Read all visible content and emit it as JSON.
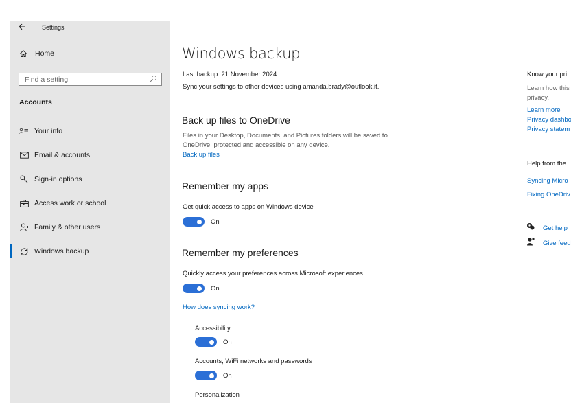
{
  "app": {
    "title": "Settings"
  },
  "sidebar": {
    "home_label": "Home",
    "search_placeholder": "Find a setting",
    "section_title": "Accounts",
    "items": [
      {
        "label": "Your info",
        "icon": "person-list-icon"
      },
      {
        "label": "Email & accounts",
        "icon": "mail-icon"
      },
      {
        "label": "Sign-in options",
        "icon": "key-icon"
      },
      {
        "label": "Access work or school",
        "icon": "briefcase-icon"
      },
      {
        "label": "Family & other users",
        "icon": "person-add-icon"
      },
      {
        "label": "Windows backup",
        "icon": "sync-icon",
        "active": true
      }
    ]
  },
  "main": {
    "title": "Windows backup",
    "last_backup": "Last backup: 21 November 2024",
    "sync_text": "Sync your settings to other devices using amanda.brady@outlook.it.",
    "onedrive": {
      "heading": "Back up files to OneDrive",
      "desc_line1": "Files in your Desktop, Documents, and Pictures folders will be saved to",
      "desc_line2": "OneDrive, protected and accessible on any device.",
      "link": "Back up files"
    },
    "apps": {
      "heading": "Remember my apps",
      "desc": "Get quick access to apps on Windows device",
      "toggle_state": "On"
    },
    "prefs": {
      "heading": "Remember my preferences",
      "desc": "Quickly access your preferences across Microsoft experiences",
      "toggle_state": "On",
      "link": "How does syncing work?",
      "sub": [
        {
          "label": "Accessibility",
          "state": "On"
        },
        {
          "label": "Accounts, WiFi networks and passwords",
          "state": "On"
        },
        {
          "label": "Personalization"
        }
      ]
    }
  },
  "right_panel": {
    "privacy_heading": "Know your pri",
    "privacy_desc_line1": "Learn how this",
    "privacy_desc_line2": "privacy.",
    "links": [
      "Learn more",
      "Privacy dashbo",
      "Privacy statem"
    ],
    "help_heading": "Help from the",
    "help_links": [
      "Syncing Micro",
      "Fixing OneDriv"
    ],
    "get_help": "Get help",
    "give_feedback": "Give feed"
  },
  "colors": {
    "accent": "#0067c0",
    "toggle_on": "#2b6fd6",
    "sidebar_bg": "#e6e6e6"
  }
}
